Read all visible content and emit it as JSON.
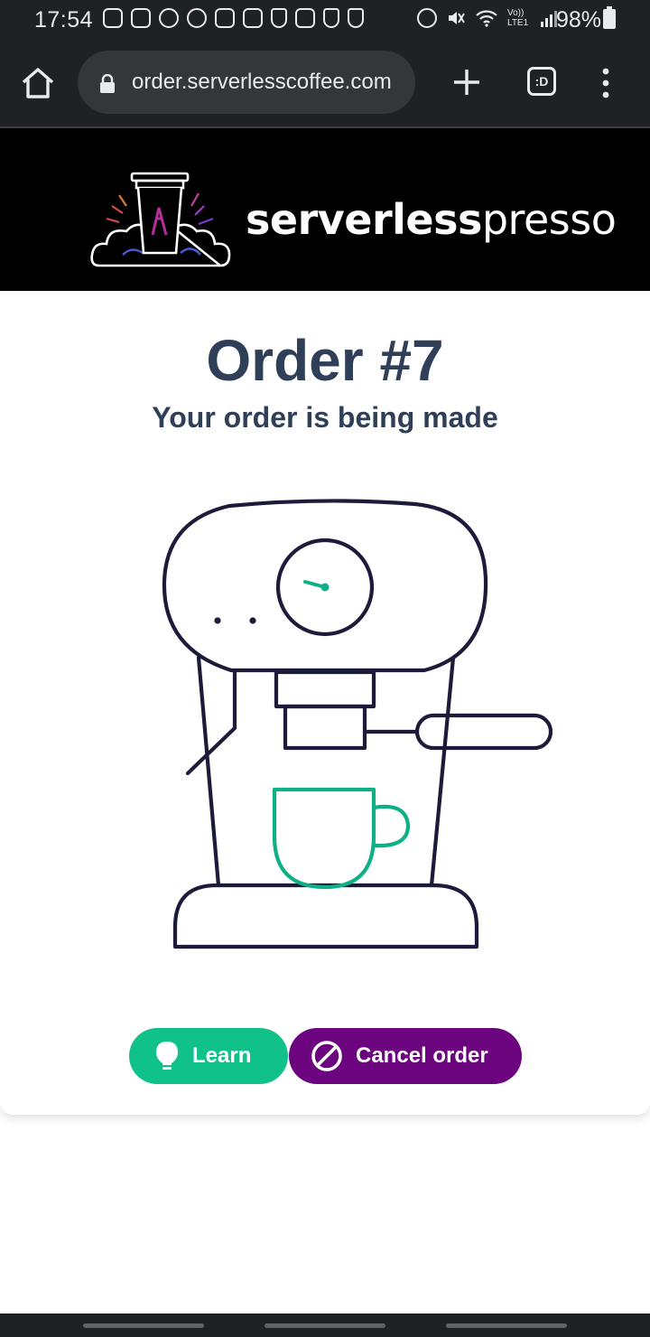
{
  "status_bar": {
    "time": "17:54",
    "battery": "98%",
    "icons_left": [
      "instagram-icon",
      "voicemail-icon",
      "alarm-icon",
      "whatsapp-icon",
      "gallery-icon",
      "linkedin-icon",
      "hand-icon",
      "linkedin-icon",
      "hand-icon",
      "hand-icon"
    ],
    "icons_right": [
      "alarm-icon",
      "mute-icon",
      "wifi-icon",
      "volte-icon",
      "signal-icon",
      "battery-icon"
    ],
    "volte_label": "Vo)) LTE1"
  },
  "browser": {
    "url": "order.serverlesscoffee.com",
    "tabs_label": ":D"
  },
  "header": {
    "logo_bold": "serverless",
    "logo_light": "presso"
  },
  "order": {
    "title": "Order #7",
    "status": "Your order is being made"
  },
  "buttons": {
    "learn": "Learn",
    "cancel": "Cancel order"
  },
  "colors": {
    "heading": "#2e3f57",
    "learn_button": "#10c28a",
    "cancel_button": "#6b047e",
    "cup": "#10b087",
    "machine_stroke": "#1c1c3a"
  }
}
